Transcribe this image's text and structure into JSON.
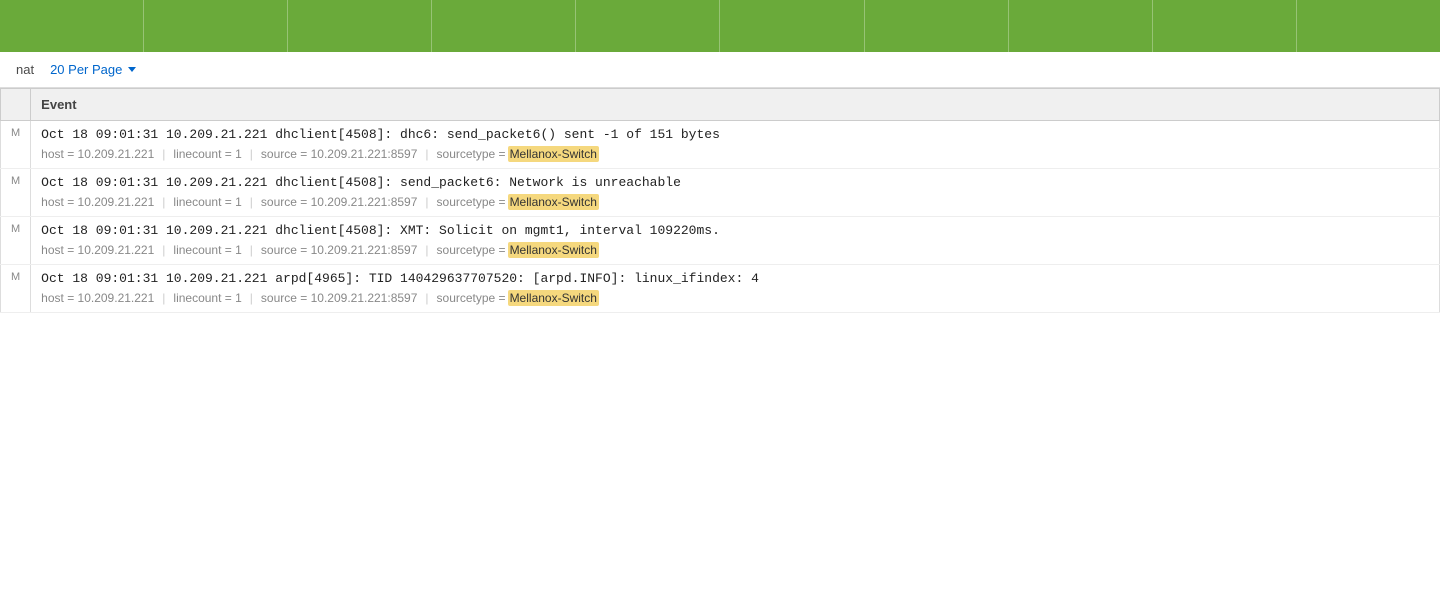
{
  "topbar": {
    "cells": [
      "",
      "",
      "",
      "",
      "",
      "",
      "",
      "",
      "",
      ""
    ],
    "color": "#6aaa3a"
  },
  "controls": {
    "format_label": "nat",
    "per_page_label": "20 Per Page",
    "per_page_chevron": "▾"
  },
  "table": {
    "header": {
      "event_col": "Event"
    },
    "rows": [
      {
        "id": 1,
        "icon": "M",
        "event": "Oct 18 09:01:31 10.209.21.221 dhclient[4508]: dhc6: send_packet6() sent -1 of 151 bytes",
        "meta": {
          "host": "host = 10.209.21.221",
          "linecount": "linecount = 1",
          "source": "source = 10.209.21.221:8597",
          "sourcetype_prefix": "sourcetype = ",
          "sourcetype_value": "Mellanox-Switch"
        }
      },
      {
        "id": 2,
        "icon": "M",
        "event": "Oct 18 09:01:31 10.209.21.221 dhclient[4508]: send_packet6: Network is unreachable",
        "meta": {
          "host": "host = 10.209.21.221",
          "linecount": "linecount = 1",
          "source": "source = 10.209.21.221:8597",
          "sourcetype_prefix": "sourcetype = ",
          "sourcetype_value": "Mellanox-Switch"
        }
      },
      {
        "id": 3,
        "icon": "M",
        "event": "Oct 18 09:01:31 10.209.21.221 dhclient[4508]: XMT: Solicit on mgmt1, interval 109220ms.",
        "meta": {
          "host": "host = 10.209.21.221",
          "linecount": "linecount = 1",
          "source": "source = 10.209.21.221:8597",
          "sourcetype_prefix": "sourcetype = ",
          "sourcetype_value": "Mellanox-Switch"
        }
      },
      {
        "id": 4,
        "icon": "M",
        "event": "Oct 18 09:01:31 10.209.21.221 arpd[4965]: TID 140429637707520: [arpd.INFO]: linux_ifindex: 4",
        "meta": {
          "host": "host = 10.209.21.221",
          "linecount": "linecount = 1",
          "source": "source = 10.209.21.221:8597",
          "sourcetype_prefix": "sourcetype = ",
          "sourcetype_value": "Mellanox-Switch"
        }
      }
    ]
  }
}
